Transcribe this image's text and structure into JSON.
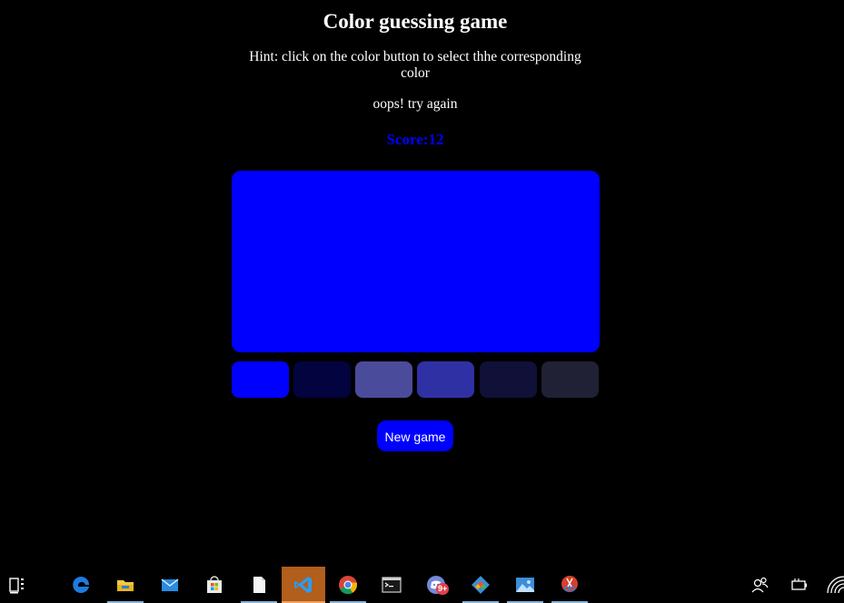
{
  "game": {
    "title": "Color guessing game",
    "hint": "Hint: click on the color button to select thhe corresponding color",
    "message": "oops! try again",
    "score": "Score:12",
    "target_color": "#0000ff",
    "options": [
      "#0000ff",
      "#03033f",
      "#4b4b9b",
      "#3030a5",
      "#101038",
      "#212135"
    ],
    "new_game_label": "New game",
    "accent": "#0000ff"
  },
  "taskbar": {
    "background": "#000000",
    "items": [
      {
        "name": "task-view-icon"
      },
      {
        "name": "edge-icon"
      },
      {
        "name": "file-explorer-icon"
      },
      {
        "name": "mail-icon"
      },
      {
        "name": "store-icon"
      },
      {
        "name": "notepad-icon"
      },
      {
        "name": "vscode-icon"
      },
      {
        "name": "chrome-icon"
      },
      {
        "name": "terminal-icon"
      },
      {
        "name": "discord-icon",
        "badge": "9+"
      },
      {
        "name": "git-icon"
      },
      {
        "name": "photos-icon"
      },
      {
        "name": "snipping-tool-icon"
      },
      {
        "name": "people-icon"
      },
      {
        "name": "battery-icon"
      },
      {
        "name": "wifi-icon"
      }
    ]
  }
}
